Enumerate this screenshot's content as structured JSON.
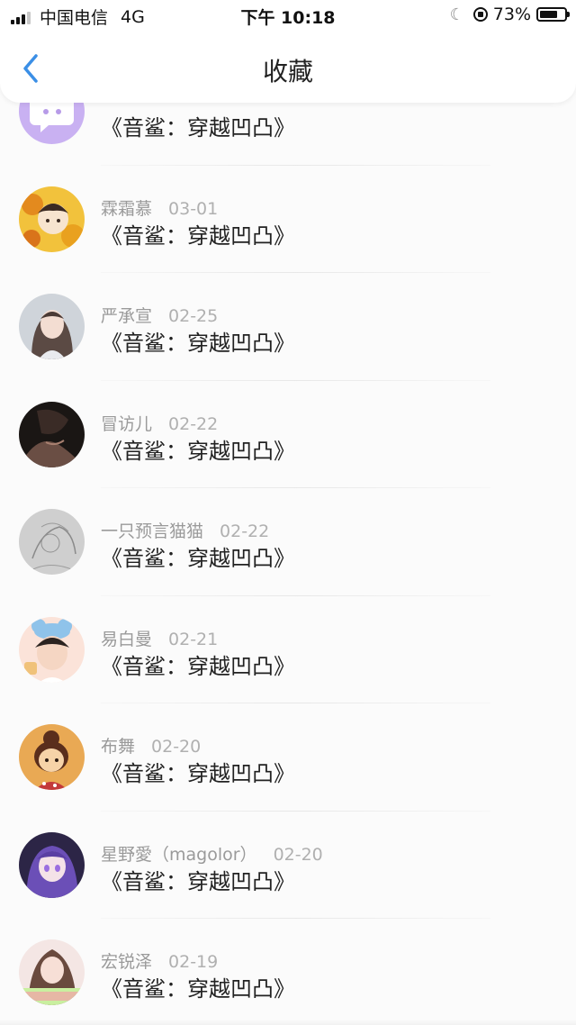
{
  "status_bar": {
    "carrier": "中国电信",
    "network": "4G",
    "time": "下午 10:18",
    "battery_percent": "73%",
    "battery_level": 0.73
  },
  "nav": {
    "title": "收藏",
    "back_icon": "chevron-left-icon",
    "accent_color": "#3b8fe6"
  },
  "favorites": [
    {
      "username": "",
      "date": "",
      "title": "《音鲨：穿越凹凸》",
      "avatar": "purple-chat-bubble-icon"
    },
    {
      "username": "霖霜慕",
      "date": "03-01",
      "title": "《音鲨：穿越凹凸》",
      "avatar": "anime-sunflower-avatar"
    },
    {
      "username": "严承宣",
      "date": "02-25",
      "title": "《音鲨：穿越凹凸》",
      "avatar": "girl-portrait-avatar"
    },
    {
      "username": "冒访儿",
      "date": "02-22",
      "title": "《音鲨：穿越凹凸》",
      "avatar": "dark-photo-avatar"
    },
    {
      "username": "一只预言猫猫",
      "date": "02-22",
      "title": "《音鲨：穿越凹凸》",
      "avatar": "sketch-avatar"
    },
    {
      "username": "易白曼",
      "date": "02-21",
      "title": "《音鲨：穿越凹凸》",
      "avatar": "cartoon-bear-ears-avatar"
    },
    {
      "username": "布舞",
      "date": "02-20",
      "title": "《音鲨：穿越凹凸》",
      "avatar": "cartoon-girl-avatar"
    },
    {
      "username": "星野愛（magolor）",
      "date": "02-20",
      "title": "《音鲨：穿越凹凸》",
      "avatar": "anime-purple-hair-avatar"
    },
    {
      "username": "宏锐泽",
      "date": "02-19",
      "title": "《音鲨：穿越凹凸》",
      "avatar": "girl-photo-avatar"
    }
  ]
}
